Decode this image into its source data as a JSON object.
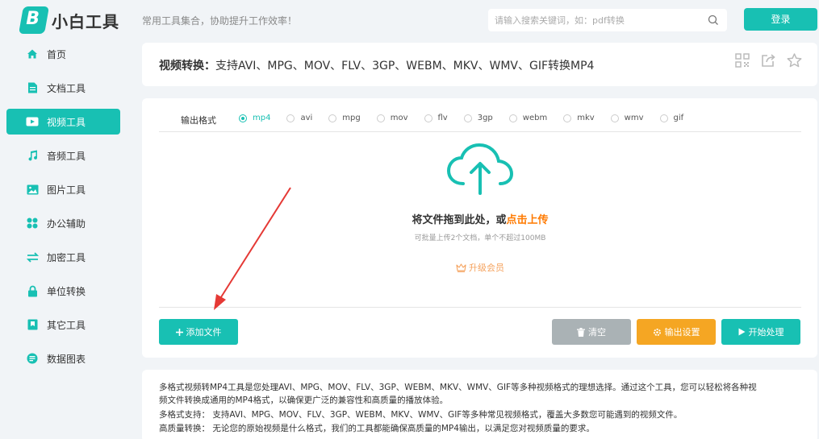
{
  "header": {
    "logo_letter": "B",
    "logo_text": "小白工具",
    "slogan": "常用工具集合，协助提升工作效率！",
    "search_placeholder": "请输入搜索关键词，如：pdf转换",
    "login_label": "登录"
  },
  "sidebar": {
    "items": [
      {
        "label": "首页",
        "icon": "home-icon"
      },
      {
        "label": "文档工具",
        "icon": "document-icon"
      },
      {
        "label": "视频工具",
        "icon": "video-icon",
        "active": true
      },
      {
        "label": "音频工具",
        "icon": "music-icon"
      },
      {
        "label": "图片工具",
        "icon": "image-icon"
      },
      {
        "label": "办公辅助",
        "icon": "apps-icon"
      },
      {
        "label": "加密工具",
        "icon": "swap-icon"
      },
      {
        "label": "单位转换",
        "icon": "lock-icon"
      },
      {
        "label": "其它工具",
        "icon": "bookmark-icon"
      },
      {
        "label": "数据图表",
        "icon": "chart-icon"
      }
    ]
  },
  "title_card": {
    "title_prefix": "视频转换：",
    "title_text": "支持AVI、MPG、MOV、FLV、3GP、WEBM、MKV、WMV、GIF转换MP4"
  },
  "tool": {
    "format_label": "输出格式",
    "formats": [
      "mp4",
      "avi",
      "mpg",
      "mov",
      "flv",
      "3gp",
      "webm",
      "mkv",
      "wmv",
      "gif"
    ],
    "selected_format": "mp4",
    "drop_text": "将文件拖到此处，或",
    "drop_link": "点击上传",
    "sub_text": "可批量上传2个文档，单个不超过100MB",
    "vip_label": "升级会员",
    "add_label": "添加文件",
    "clear_label": "清空",
    "settings_label": "输出设置",
    "start_label": "开始处理"
  },
  "description": {
    "lines": [
      "多格式视频转MP4工具是您处理AVI、MPG、MOV、FLV、3GP、WEBM、MKV、WMV、GIF等多种视频格式的理想选择。通过这个工具，您可以轻松将各种视",
      "频文件转换成通用的MP4格式，以确保更广泛的兼容性和高质量的播放体验。",
      "多格式支持： 支持AVI、MPG、MOV、FLV、3GP、WEBM、MKV、WMV、GIF等多种常见视频格式，覆盖大多数您可能遇到的视频文件。",
      "高质量转换： 无论您的原始视频是什么格式，我们的工具都能确保高质量的MP4输出，以满足您对视频质量的要求。"
    ]
  },
  "colors": {
    "accent": "#18c0b3",
    "orange": "#f5a623",
    "gray_button": "#aab2b5",
    "highlight": "#ff7a00",
    "annotation_red": "#e53935"
  }
}
